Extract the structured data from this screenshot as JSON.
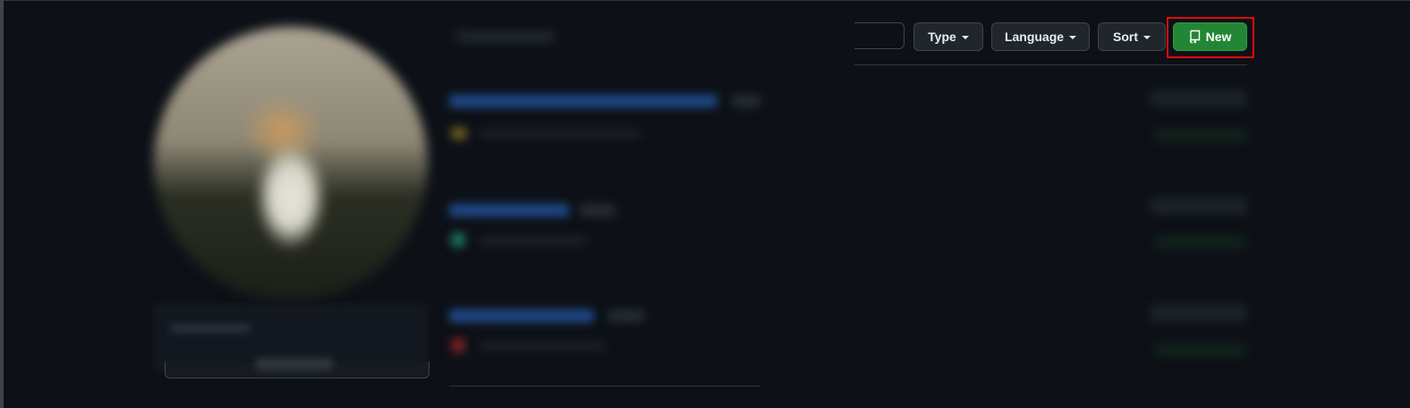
{
  "toolbar": {
    "type_label": "Type",
    "language_label": "Language",
    "sort_label": "Sort",
    "new_label": "New"
  },
  "icons": {
    "dropdown": "caret-down-icon",
    "new": "repo-icon"
  },
  "colors": {
    "background": "#0d1117",
    "button_bg": "#21262d",
    "button_border": "#3d444d",
    "new_button_bg": "#238636",
    "highlight": "#e00b0b"
  }
}
